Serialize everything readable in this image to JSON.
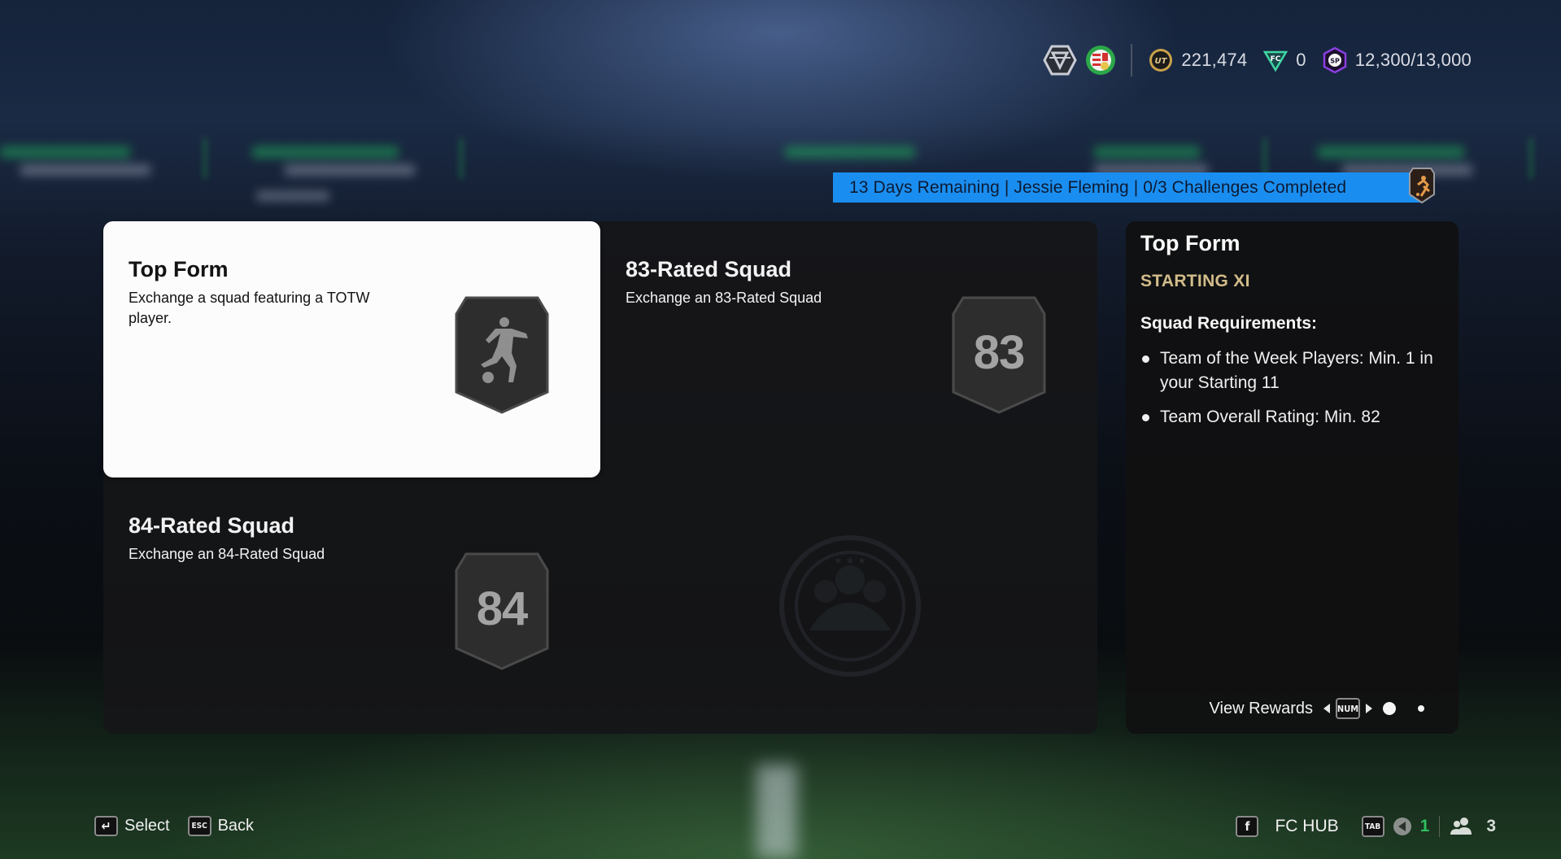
{
  "topbar": {
    "icons": [
      "division-rank-icon",
      "club-badge-icon"
    ],
    "coins": {
      "icon": "ut-coins-icon",
      "value": "221,474"
    },
    "fc_points": {
      "icon": "fc-points-icon",
      "value": "0"
    },
    "season_points": {
      "icon": "sp-icon",
      "label": "SP",
      "value": "12,300/13,000"
    }
  },
  "banner": {
    "text": "13 Days Remaining | Jessie Fleming | 0/3 Challenges Completed",
    "badge_icon": "player-reward-badge-icon",
    "color": "#1a8ef0"
  },
  "challenges": [
    {
      "title": "Top Form",
      "description": "Exchange a squad featuring a TOTW player.",
      "badge": "player-kick-icon",
      "selected": true
    },
    {
      "title": "83-Rated Squad",
      "description": "Exchange an 83-Rated Squad",
      "badge_number": "83",
      "selected": false
    },
    {
      "title": "84-Rated Squad",
      "description": "Exchange an 84-Rated Squad",
      "badge_number": "84",
      "selected": false
    }
  ],
  "detail": {
    "title": "Top Form",
    "subtitle": "STARTING XI",
    "requirements_label": "Squad Requirements:",
    "requirements": [
      "Team of the Week Players: Min. 1 in your Starting 11",
      "Team Overall Rating: Min. 82"
    ],
    "footer": {
      "label": "View Rewards",
      "key": "NUM",
      "pages": 2,
      "active_page": 1
    },
    "accent": "#d2bc8a"
  },
  "bottom_left": [
    {
      "key": "↵",
      "label": "Select"
    },
    {
      "key": "ESC",
      "label": "Back"
    }
  ],
  "bottom_right": {
    "hub_key": "f",
    "hub_label": "FC HUB",
    "tab_key": "TAB",
    "notifications": "1",
    "friends": "3",
    "notification_color": "#2fbf5f"
  }
}
